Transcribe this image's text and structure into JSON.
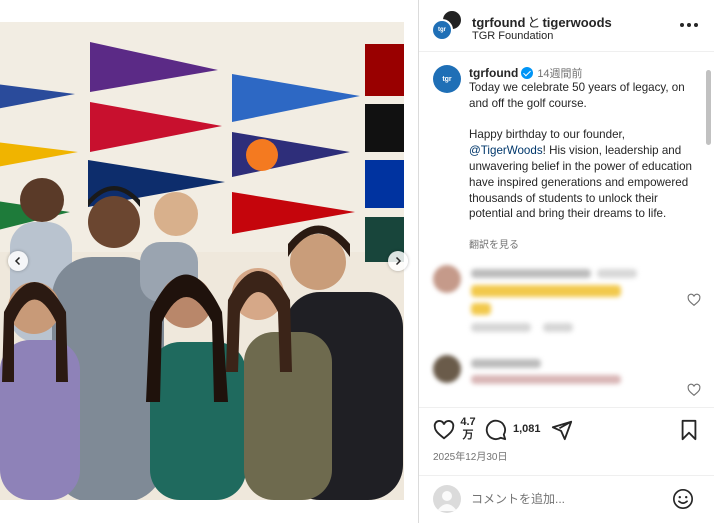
{
  "header": {
    "user_primary": "tgrfound",
    "conjunction": "と",
    "user_secondary": "tigerwoods",
    "subtitle": "TGR Foundation",
    "more_label": "…"
  },
  "caption": {
    "username": "tgrfound",
    "time_ago": "14週間前",
    "paragraph1": "Today we celebrate 50 years of legacy, on and off the golf course.",
    "paragraph2_before": "Happy birthday to our founder, ",
    "mention": "@TigerWoods",
    "paragraph2_after": "! His vision, leadership and unwavering belief in the power of education have inspired generations and empowered thousands of students to unlock their potential and bring their dreams to life.",
    "translate_label": "翻訳を見る"
  },
  "actions": {
    "like_count": "4.7万",
    "comment_count": "1,081",
    "date": "2025年12月30日"
  },
  "add_comment": {
    "placeholder": "コメントを追加..."
  },
  "colors": {
    "accent": "#0095f6",
    "mention": "#00376b",
    "muted": "#737373",
    "text": "#262626",
    "border": "#dbdbdb"
  },
  "icons": {
    "verified": "verified-badge-icon",
    "like": "heart-icon",
    "comment": "speech-bubble-icon",
    "share": "paper-plane-icon",
    "save": "bookmark-icon",
    "emoji": "smiley-icon",
    "more": "ellipsis-icon",
    "prev": "chevron-left-icon",
    "next": "chevron-right-icon"
  }
}
